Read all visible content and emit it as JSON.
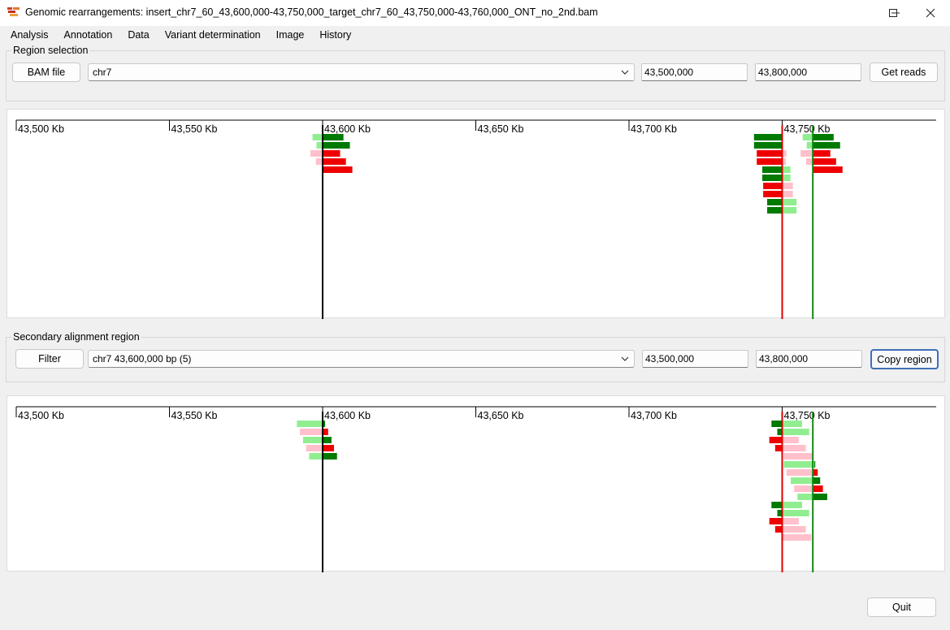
{
  "window": {
    "title": "Genomic rearrangements: insert_chr7_60_43,600,000-43,750,000_target_chr7_60_43,750,000-43,760,000_ONT_no_2nd.bam",
    "controls": [
      "minimize-icon",
      "maximize-icon",
      "close-icon"
    ]
  },
  "menu": [
    "Analysis",
    "Annotation",
    "Data",
    "Variant determination",
    "Image",
    "History"
  ],
  "region_selection": {
    "label": "Region selection",
    "bam_button": "BAM file",
    "chromosome": "chr7",
    "start": "43,500,000",
    "end": "43,800,000",
    "get_reads_button": "Get reads"
  },
  "secondary_region": {
    "label": "Secondary alignment region",
    "filter_button": "Filter",
    "region": "chr7 43,600,000 bp (5)",
    "start": "43,500,000",
    "end": "43,800,000",
    "copy_button": "Copy region"
  },
  "colors": {
    "dark_green": "#007a00",
    "light_green": "#90ee90",
    "red": "#ee0000",
    "pink": "#ffc0cb",
    "breakpoint_red": "#dd0000",
    "breakpoint_green": "#118811"
  },
  "chart_data": [
    {
      "type": "alignment-track",
      "axis_min": 43500000,
      "axis_max": 43800000,
      "tick_labels": [
        "43,500 Kb",
        "43,550 Kb",
        "43,600 Kb",
        "43,650 Kb",
        "43,700 Kb",
        "43,750 Kb"
      ],
      "breakpoints": [
        {
          "pos": 43600000,
          "color": "#000000"
        },
        {
          "pos": 43750000,
          "color": "#dd0000"
        },
        {
          "pos": 43760000,
          "color": "#118811"
        }
      ],
      "reads": [
        {
          "row": 0,
          "start": 43596700,
          "end": 43600000,
          "color": "#90ee90"
        },
        {
          "row": 0,
          "start": 43600000,
          "end": 43606800,
          "color": "#007a00"
        },
        {
          "row": 1,
          "start": 43598000,
          "end": 43600000,
          "color": "#90ee90"
        },
        {
          "row": 1,
          "start": 43600000,
          "end": 43608900,
          "color": "#007a00"
        },
        {
          "row": 2,
          "start": 43596000,
          "end": 43600000,
          "color": "#ffc0cb"
        },
        {
          "row": 2,
          "start": 43600000,
          "end": 43605700,
          "color": "#ee0000"
        },
        {
          "row": 3,
          "start": 43597800,
          "end": 43600000,
          "color": "#ffc0cb"
        },
        {
          "row": 3,
          "start": 43600000,
          "end": 43607600,
          "color": "#ee0000"
        },
        {
          "row": 4,
          "start": 43600000,
          "end": 43609700,
          "color": "#ee0000"
        },
        {
          "row": 0,
          "start": 43740800,
          "end": 43750000,
          "color": "#007a00"
        },
        {
          "row": 1,
          "start": 43740800,
          "end": 43750000,
          "color": "#007a00"
        },
        {
          "row": 2,
          "start": 43741700,
          "end": 43750000,
          "color": "#ee0000"
        },
        {
          "row": 2,
          "start": 43750000,
          "end": 43751400,
          "color": "#ffc0cb"
        },
        {
          "row": 3,
          "start": 43741700,
          "end": 43750000,
          "color": "#ee0000"
        },
        {
          "row": 3,
          "start": 43750000,
          "end": 43751200,
          "color": "#ffc0cb"
        },
        {
          "row": 4,
          "start": 43743500,
          "end": 43750000,
          "color": "#007a00"
        },
        {
          "row": 4,
          "start": 43750000,
          "end": 43752700,
          "color": "#90ee90"
        },
        {
          "row": 5,
          "start": 43743500,
          "end": 43750000,
          "color": "#007a00"
        },
        {
          "row": 5,
          "start": 43750000,
          "end": 43752700,
          "color": "#90ee90"
        },
        {
          "row": 6,
          "start": 43743800,
          "end": 43750000,
          "color": "#ee0000"
        },
        {
          "row": 6,
          "start": 43750000,
          "end": 43753500,
          "color": "#ffc0cb"
        },
        {
          "row": 7,
          "start": 43743800,
          "end": 43750000,
          "color": "#ee0000"
        },
        {
          "row": 7,
          "start": 43750000,
          "end": 43753500,
          "color": "#ffc0cb"
        },
        {
          "row": 8,
          "start": 43745100,
          "end": 43750000,
          "color": "#007a00"
        },
        {
          "row": 8,
          "start": 43750000,
          "end": 43754700,
          "color": "#90ee90"
        },
        {
          "row": 9,
          "start": 43745100,
          "end": 43750000,
          "color": "#007a00"
        },
        {
          "row": 9,
          "start": 43750000,
          "end": 43754700,
          "color": "#90ee90"
        },
        {
          "row": 0,
          "start": 43756700,
          "end": 43760000,
          "color": "#90ee90"
        },
        {
          "row": 0,
          "start": 43760000,
          "end": 43766800,
          "color": "#007a00"
        },
        {
          "row": 1,
          "start": 43758000,
          "end": 43760000,
          "color": "#90ee90"
        },
        {
          "row": 1,
          "start": 43760000,
          "end": 43768900,
          "color": "#007a00"
        },
        {
          "row": 2,
          "start": 43756000,
          "end": 43760000,
          "color": "#ffc0cb"
        },
        {
          "row": 2,
          "start": 43760000,
          "end": 43765700,
          "color": "#ee0000"
        },
        {
          "row": 3,
          "start": 43757800,
          "end": 43760000,
          "color": "#ffc0cb"
        },
        {
          "row": 3,
          "start": 43760000,
          "end": 43767600,
          "color": "#ee0000"
        },
        {
          "row": 4,
          "start": 43760000,
          "end": 43769700,
          "color": "#ee0000"
        }
      ]
    },
    {
      "type": "alignment-track",
      "axis_min": 43500000,
      "axis_max": 43800000,
      "tick_labels": [
        "43,500 Kb",
        "43,550 Kb",
        "43,600 Kb",
        "43,650 Kb",
        "43,700 Kb",
        "43,750 Kb"
      ],
      "breakpoints": [
        {
          "pos": 43600000,
          "color": "#000000"
        },
        {
          "pos": 43750000,
          "color": "#dd0000"
        },
        {
          "pos": 43760000,
          "color": "#118811"
        }
      ],
      "reads": [
        {
          "row": 0,
          "start": 43591600,
          "end": 43600000,
          "color": "#90ee90"
        },
        {
          "row": 0,
          "start": 43600000,
          "end": 43600800,
          "color": "#007a00"
        },
        {
          "row": 1,
          "start": 43592600,
          "end": 43600000,
          "color": "#ffc0cb"
        },
        {
          "row": 1,
          "start": 43600000,
          "end": 43601800,
          "color": "#ee0000"
        },
        {
          "row": 2,
          "start": 43593600,
          "end": 43600000,
          "color": "#90ee90"
        },
        {
          "row": 2,
          "start": 43600000,
          "end": 43602900,
          "color": "#007a00"
        },
        {
          "row": 3,
          "start": 43594600,
          "end": 43600000,
          "color": "#ffc0cb"
        },
        {
          "row": 3,
          "start": 43600000,
          "end": 43603700,
          "color": "#ee0000"
        },
        {
          "row": 4,
          "start": 43595600,
          "end": 43600000,
          "color": "#90ee90"
        },
        {
          "row": 4,
          "start": 43600000,
          "end": 43604700,
          "color": "#007a00"
        },
        {
          "row": 0,
          "start": 43746500,
          "end": 43750000,
          "color": "#007a00"
        },
        {
          "row": 0,
          "start": 43750000,
          "end": 43756500,
          "color": "#90ee90"
        },
        {
          "row": 1,
          "start": 43748400,
          "end": 43750000,
          "color": "#007a00"
        },
        {
          "row": 1,
          "start": 43750000,
          "end": 43758800,
          "color": "#90ee90"
        },
        {
          "row": 2,
          "start": 43745800,
          "end": 43750000,
          "color": "#ee0000"
        },
        {
          "row": 2,
          "start": 43750000,
          "end": 43755400,
          "color": "#ffc0cb"
        },
        {
          "row": 3,
          "start": 43747700,
          "end": 43750000,
          "color": "#ee0000"
        },
        {
          "row": 3,
          "start": 43750000,
          "end": 43757700,
          "color": "#ffc0cb"
        },
        {
          "row": 4,
          "start": 43750500,
          "end": 43759800,
          "color": "#ffc0cb"
        },
        {
          "row": 5,
          "start": 43750500,
          "end": 43760500,
          "color": "#90ee90"
        },
        {
          "row": 5,
          "start": 43760500,
          "end": 43760800,
          "color": "#007a00"
        },
        {
          "row": 6,
          "start": 43751400,
          "end": 43760000,
          "color": "#ffc0cb"
        },
        {
          "row": 6,
          "start": 43760000,
          "end": 43761600,
          "color": "#ee0000"
        },
        {
          "row": 7,
          "start": 43752800,
          "end": 43760000,
          "color": "#90ee90"
        },
        {
          "row": 7,
          "start": 43760000,
          "end": 43762400,
          "color": "#007a00"
        },
        {
          "row": 8,
          "start": 43753900,
          "end": 43760000,
          "color": "#ffc0cb"
        },
        {
          "row": 8,
          "start": 43760000,
          "end": 43763300,
          "color": "#ee0000"
        },
        {
          "row": 9,
          "start": 43755000,
          "end": 43760000,
          "color": "#90ee90"
        },
        {
          "row": 9,
          "start": 43760000,
          "end": 43764700,
          "color": "#007a00"
        },
        {
          "row": 10,
          "start": 43746500,
          "end": 43750000,
          "color": "#007a00"
        },
        {
          "row": 10,
          "start": 43750000,
          "end": 43756500,
          "color": "#90ee90"
        },
        {
          "row": 11,
          "start": 43748400,
          "end": 43750000,
          "color": "#007a00"
        },
        {
          "row": 11,
          "start": 43750000,
          "end": 43758800,
          "color": "#90ee90"
        },
        {
          "row": 12,
          "start": 43745800,
          "end": 43750000,
          "color": "#ee0000"
        },
        {
          "row": 12,
          "start": 43750000,
          "end": 43755400,
          "color": "#ffc0cb"
        },
        {
          "row": 13,
          "start": 43747700,
          "end": 43750000,
          "color": "#ee0000"
        },
        {
          "row": 13,
          "start": 43750000,
          "end": 43757700,
          "color": "#ffc0cb"
        },
        {
          "row": 14,
          "start": 43750000,
          "end": 43759500,
          "color": "#ffc0cb"
        }
      ]
    }
  ],
  "footer": {
    "quit_button": "Quit"
  }
}
